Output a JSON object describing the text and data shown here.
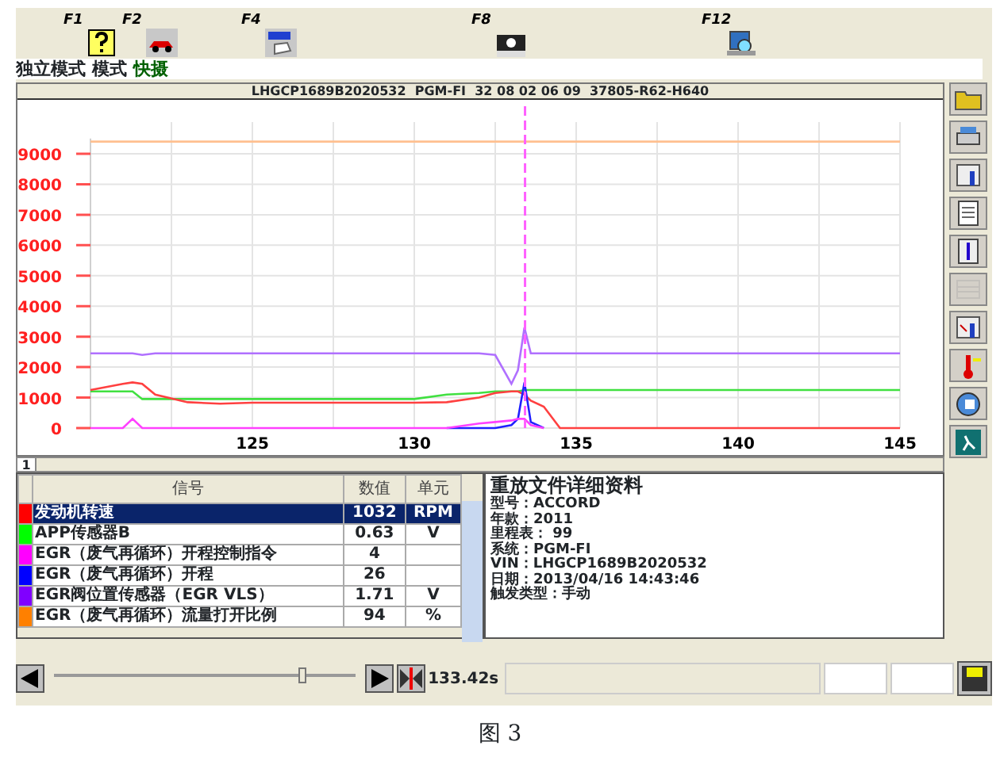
{
  "toolbar": [
    {
      "key": "F1"
    },
    {
      "key": "F2"
    },
    {
      "key": "F4"
    },
    {
      "key": "F8"
    },
    {
      "key": "F12"
    }
  ],
  "mode_bar": [
    {
      "label": "独立模式",
      "selected": false
    },
    {
      "label": "模式",
      "selected": false
    },
    {
      "label": "快摄",
      "selected": true
    }
  ],
  "chart_panel": {
    "header": "LHGCP1689B2020532  PGM-FI  32 08 02 06 09  37805-R62-H640",
    "chart_data": {
      "type": "line",
      "grid": true,
      "xlim": [
        120,
        145
      ],
      "ylim": [
        0,
        9500
      ],
      "xticks": [
        125,
        130,
        135,
        140,
        145
      ],
      "yticks": [
        0,
        1000,
        2000,
        3000,
        4000,
        5000,
        6000,
        7000,
        8000,
        9000
      ],
      "x": [
        120,
        121,
        121.3,
        121.6,
        122,
        123,
        124,
        125,
        130,
        131,
        132,
        132.5,
        133,
        133.2,
        133.4,
        133.6,
        134,
        134.5,
        135,
        140,
        145
      ],
      "series": [
        {
          "color": "#ffc090",
          "values": [
            9400,
            9400,
            9400,
            9400,
            9400,
            9400,
            9400,
            9400,
            9400,
            9400,
            9400,
            9400,
            9400,
            9400,
            9400,
            9400,
            9400,
            9400,
            9400,
            9400,
            9400
          ]
        },
        {
          "color": "#b070ff",
          "values": [
            2450,
            2450,
            2450,
            2400,
            2450,
            2450,
            2450,
            2450,
            2450,
            2450,
            2450,
            2400,
            1450,
            1900,
            3300,
            2450,
            2450,
            2450,
            2450,
            2450,
            2450
          ]
        },
        {
          "color": "#40e040",
          "values": [
            1200,
            1200,
            1200,
            950,
            950,
            950,
            950,
            950,
            950,
            1100,
            1150,
            1200,
            1200,
            1200,
            1250,
            1250,
            1250,
            1250,
            1250,
            1250,
            1250
          ]
        },
        {
          "color": "#ff4040",
          "values": [
            1250,
            1450,
            1500,
            1450,
            1100,
            850,
            800,
            830,
            830,
            850,
            1000,
            1150,
            1200,
            1200,
            1100,
            900,
            700,
            0,
            0,
            0,
            0
          ]
        },
        {
          "color": "#2020ff",
          "values": [
            null,
            null,
            null,
            null,
            null,
            null,
            null,
            null,
            null,
            0,
            0,
            0,
            100,
            300,
            1500,
            200,
            0,
            null,
            null,
            null,
            null
          ]
        },
        {
          "color": "#ff40ff",
          "values": [
            0,
            0,
            300,
            0,
            0,
            0,
            0,
            0,
            0,
            0,
            150,
            200,
            250,
            300,
            300,
            100,
            0,
            null,
            null,
            null,
            null
          ]
        }
      ],
      "ref_lines": [
        {
          "axis": "x",
          "value": 133.42
        }
      ]
    },
    "page_tab": "1"
  },
  "side_buttons": [
    {
      "disabled": false
    },
    {
      "disabled": false
    },
    {
      "disabled": false
    },
    {
      "disabled": false
    },
    {
      "disabled": false
    },
    {
      "disabled": true
    },
    {
      "disabled": false
    },
    {
      "disabled": false
    },
    {
      "disabled": false
    },
    {
      "disabled": false
    }
  ],
  "signal_table": {
    "columns": [
      "信号",
      "数值",
      "单元"
    ],
    "rows": [
      {
        "color": "#ff0000",
        "signal": "发动机转速",
        "value": "1032",
        "unit": "RPM",
        "selected": true
      },
      {
        "color": "#00ff00",
        "signal": "APP传感器B",
        "value": "0.63",
        "unit": "V",
        "selected": false
      },
      {
        "color": "#ff00ff",
        "signal": "EGR（废气再循环）开程控制指令",
        "value": "4",
        "selected": false
      },
      {
        "color": "#0000ff",
        "signal": "EGR（废气再循环）开程",
        "value": "26",
        "selected": false
      },
      {
        "color": "#8000ff",
        "signal": "EGR阀位置传感器（EGR VLS）",
        "value": "1.71",
        "unit": "V",
        "selected": false
      },
      {
        "color": "#ff8000",
        "signal": "EGR（废气再循环）流量打开比例",
        "value": "94",
        "unit": "%",
        "selected": false
      }
    ]
  },
  "details": {
    "title": "重放文件详细资料",
    "lines": [
      "型号：ACCORD",
      "年款：2011",
      "里程表： 99",
      "系统：PGM-FI",
      "VIN：LHGCP1689B2020532",
      "日期：2013/04/16 14:43:46",
      "触发类型：手动"
    ]
  },
  "playback": {
    "level": 0.83,
    "time": "133.42s"
  },
  "caption": "图 3"
}
